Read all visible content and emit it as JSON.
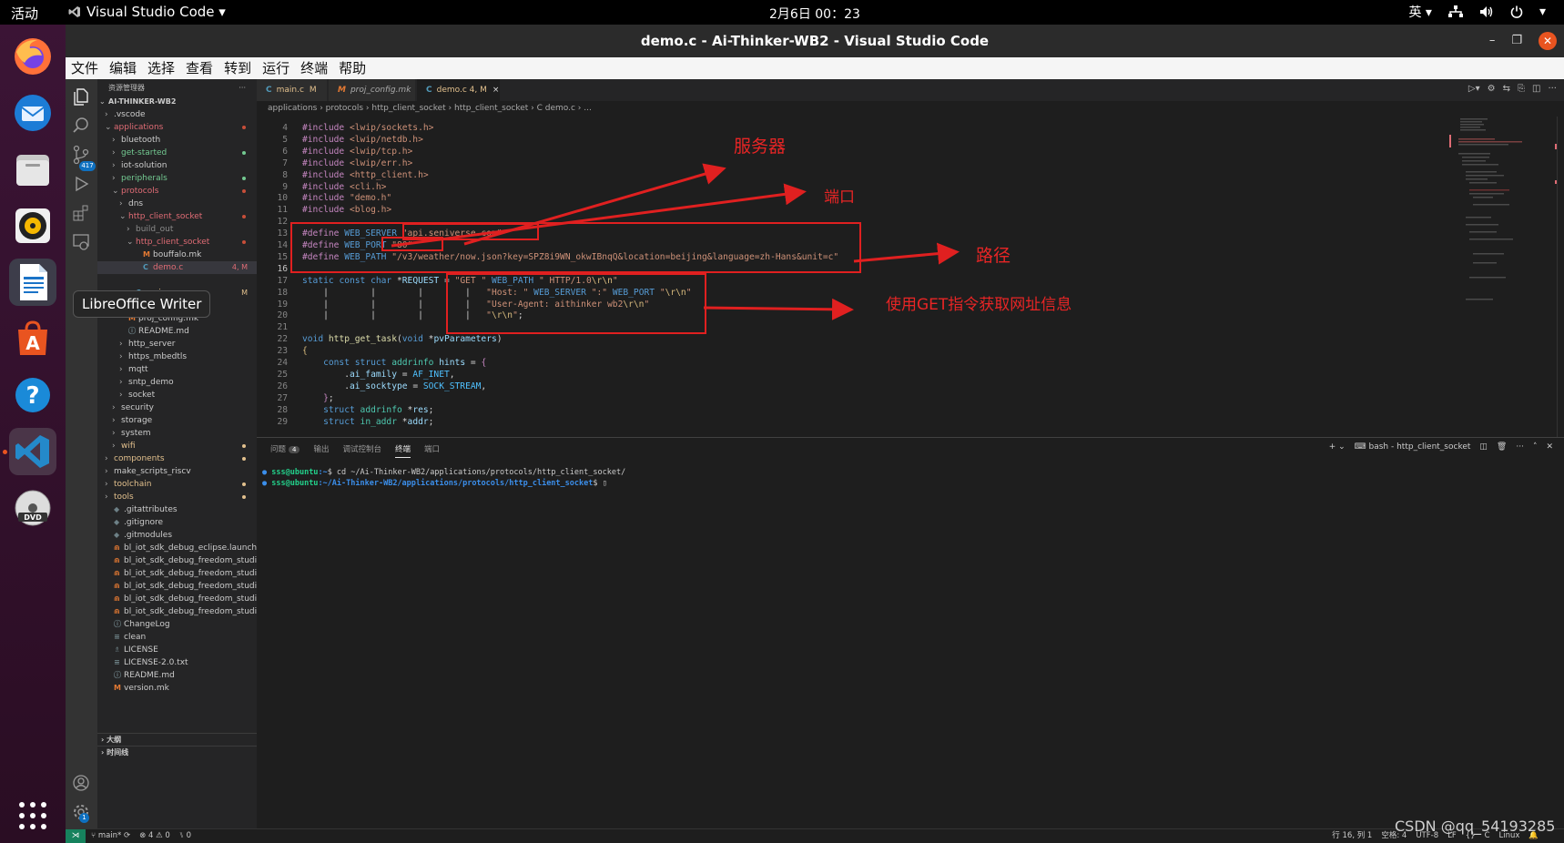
{
  "topbar": {
    "activities": "活动",
    "app_name": "Visual Studio Code ▾",
    "clock": "2月6日  00：23",
    "lang": "英 ▾",
    "network_icon": "network-icon",
    "volume_icon": "volume-icon",
    "power_icon": "power-icon"
  },
  "dock": {
    "items": [
      "firefox-icon",
      "thunderbird-icon",
      "files-icon",
      "rhythmbox-icon",
      "libreoffice-writer-icon",
      "app-center-icon",
      "help-icon",
      "vscode-icon",
      "dvd-icon",
      "show-apps-icon"
    ],
    "tooltip": "LibreOffice Writer"
  },
  "window": {
    "title": "demo.c - Ai-Thinker-WB2 - Visual Studio Code"
  },
  "menu": [
    "文件",
    "编辑",
    "选择",
    "查看",
    "转到",
    "运行",
    "终端",
    "帮助"
  ],
  "activity": {
    "scm_badge": "417",
    "settings_badge": "1"
  },
  "explorer": {
    "title": "资源管理器",
    "more": "···",
    "root": "AI-THINKER-WB2",
    "rows": [
      {
        "label": ".vscode",
        "indent": 1,
        "chev": "›",
        "icon": "",
        "color": "#cccccc"
      },
      {
        "label": "applications",
        "indent": 1,
        "chev": "⌄",
        "icon": "",
        "color": "#e06c75",
        "dot": "#c74e39"
      },
      {
        "label": "bluetooth",
        "indent": 2,
        "chev": "›",
        "icon": "",
        "color": "#cccccc"
      },
      {
        "label": "get-started",
        "indent": 2,
        "chev": "›",
        "icon": "",
        "color": "#73c991",
        "dot": "#73c991"
      },
      {
        "label": "iot-solution",
        "indent": 2,
        "chev": "›",
        "icon": "",
        "color": "#cccccc"
      },
      {
        "label": "peripherals",
        "indent": 2,
        "chev": "›",
        "icon": "",
        "color": "#73c991",
        "dot": "#73c991"
      },
      {
        "label": "protocols",
        "indent": 2,
        "chev": "⌄",
        "icon": "",
        "color": "#e06c75",
        "dot": "#c74e39"
      },
      {
        "label": "dns",
        "indent": 3,
        "chev": "›",
        "icon": "",
        "color": "#cccccc"
      },
      {
        "label": "http_client_socket",
        "indent": 3,
        "chev": "⌄",
        "icon": "",
        "color": "#e06c75",
        "dot": "#c74e39"
      },
      {
        "label": "build_out",
        "indent": 4,
        "chev": "›",
        "icon": "",
        "color": "#8b8b8b"
      },
      {
        "label": "http_client_socket",
        "indent": 4,
        "chev": "⌄",
        "icon": "",
        "color": "#e06c75",
        "dot": "#c74e39"
      },
      {
        "label": "bouffalo.mk",
        "indent": 5,
        "chev": "",
        "icon": "M",
        "color": "#cccccc"
      },
      {
        "label": "demo.c",
        "indent": 5,
        "chev": "",
        "icon": "C",
        "color": "#e06c75",
        "badge": "4, M",
        "selected": true
      },
      {
        "label": "",
        "indent": 5,
        "chev": "",
        "icon": "",
        "color": "#cccccc"
      },
      {
        "label": "main.c",
        "indent": 4,
        "chev": "",
        "icon": "C",
        "color": "#e2c08d",
        "badge": "M"
      },
      {
        "label": "Makefile",
        "indent": 3,
        "chev": "",
        "icon": "M",
        "color": "#cccccc"
      },
      {
        "label": "proj_config.mk",
        "indent": 3,
        "chev": "",
        "icon": "M",
        "color": "#cccccc"
      },
      {
        "label": "README.md",
        "indent": 3,
        "chev": "",
        "icon": "ⓘ",
        "color": "#cccccc"
      },
      {
        "label": "http_server",
        "indent": 3,
        "chev": "›",
        "icon": "",
        "color": "#cccccc"
      },
      {
        "label": "https_mbedtls",
        "indent": 3,
        "chev": "›",
        "icon": "",
        "color": "#cccccc"
      },
      {
        "label": "mqtt",
        "indent": 3,
        "chev": "›",
        "icon": "",
        "color": "#cccccc"
      },
      {
        "label": "sntp_demo",
        "indent": 3,
        "chev": "›",
        "icon": "",
        "color": "#cccccc"
      },
      {
        "label": "socket",
        "indent": 3,
        "chev": "›",
        "icon": "",
        "color": "#cccccc"
      },
      {
        "label": "security",
        "indent": 2,
        "chev": "›",
        "icon": "",
        "color": "#cccccc"
      },
      {
        "label": "storage",
        "indent": 2,
        "chev": "›",
        "icon": "",
        "color": "#cccccc"
      },
      {
        "label": "system",
        "indent": 2,
        "chev": "›",
        "icon": "",
        "color": "#cccccc"
      },
      {
        "label": "wifi",
        "indent": 2,
        "chev": "›",
        "icon": "",
        "color": "#e2c08d",
        "dot": "#e2c08d"
      },
      {
        "label": "components",
        "indent": 1,
        "chev": "›",
        "icon": "",
        "color": "#e2c08d",
        "dot": "#e2c08d"
      },
      {
        "label": "make_scripts_riscv",
        "indent": 1,
        "chev": "›",
        "icon": "",
        "color": "#cccccc"
      },
      {
        "label": "toolchain",
        "indent": 1,
        "chev": "›",
        "icon": "",
        "color": "#e2c08d",
        "dot": "#e2c08d"
      },
      {
        "label": "tools",
        "indent": 1,
        "chev": "›",
        "icon": "",
        "color": "#e2c08d",
        "dot": "#e2c08d"
      },
      {
        "label": ".gitattributes",
        "indent": 1,
        "chev": "",
        "icon": "◆",
        "color": "#cccccc"
      },
      {
        "label": ".gitignore",
        "indent": 1,
        "chev": "",
        "icon": "◆",
        "color": "#cccccc"
      },
      {
        "label": ".gitmodules",
        "indent": 1,
        "chev": "",
        "icon": "◆",
        "color": "#cccccc"
      },
      {
        "label": "bl_iot_sdk_debug_eclipse.launch",
        "indent": 1,
        "chev": "",
        "icon": "⋒",
        "color": "#cccccc"
      },
      {
        "label": "bl_iot_sdk_debug_freedom_studio...",
        "indent": 1,
        "chev": "",
        "icon": "⋒",
        "color": "#cccccc"
      },
      {
        "label": "bl_iot_sdk_debug_freedom_studio...",
        "indent": 1,
        "chev": "",
        "icon": "⋒",
        "color": "#cccccc"
      },
      {
        "label": "bl_iot_sdk_debug_freedom_studio...",
        "indent": 1,
        "chev": "",
        "icon": "⋒",
        "color": "#cccccc"
      },
      {
        "label": "bl_iot_sdk_debug_freedom_studio...",
        "indent": 1,
        "chev": "",
        "icon": "⋒",
        "color": "#cccccc"
      },
      {
        "label": "bl_iot_sdk_debug_freedom_studio...",
        "indent": 1,
        "chev": "",
        "icon": "⋒",
        "color": "#cccccc"
      },
      {
        "label": "ChangeLog",
        "indent": 1,
        "chev": "",
        "icon": "ⓘ",
        "color": "#cccccc"
      },
      {
        "label": "clean",
        "indent": 1,
        "chev": "",
        "icon": "≡",
        "color": "#cccccc"
      },
      {
        "label": "LICENSE",
        "indent": 1,
        "chev": "",
        "icon": "♗",
        "color": "#cccccc"
      },
      {
        "label": "LICENSE-2.0.txt",
        "indent": 1,
        "chev": "",
        "icon": "≡",
        "color": "#cccccc"
      },
      {
        "label": "README.md",
        "indent": 1,
        "chev": "",
        "icon": "ⓘ",
        "color": "#cccccc"
      },
      {
        "label": "version.mk",
        "indent": 1,
        "chev": "",
        "icon": "M",
        "color": "#cccccc"
      }
    ],
    "outline": "大纲",
    "timeline": "时间线"
  },
  "tabs": [
    {
      "icon": "C",
      "label": "main.c",
      "badge": "M",
      "italic": false
    },
    {
      "icon": "M",
      "label": "proj_config.mk",
      "badge": "",
      "italic": true
    },
    {
      "icon": "C",
      "label": "demo.c 4, M",
      "badge": "",
      "italic": false,
      "active": true
    }
  ],
  "tab_close": "×",
  "breadcrumb": "applications › protocols › http_client_socket › http_client_socket › C demo.c › ...",
  "code": [
    {
      "n": "4",
      "html": "<span class='k-pp'>#include</span> <span class='k-inc'>&lt;lwip/sockets.h&gt;</span>"
    },
    {
      "n": "5",
      "html": "<span class='k-pp'>#include</span> <span class='k-inc'>&lt;lwip/netdb.h&gt;</span>"
    },
    {
      "n": "6",
      "html": "<span class='k-pp'>#include</span> <span class='k-inc'>&lt;lwip/tcp.h&gt;</span>"
    },
    {
      "n": "7",
      "html": "<span class='k-pp'>#include</span> <span class='k-inc'>&lt;lwip/err.h&gt;</span>"
    },
    {
      "n": "8",
      "html": "<span class='k-pp'>#include</span> <span class='k-inc'>&lt;http_client.h&gt;</span>"
    },
    {
      "n": "9",
      "html": "<span class='k-pp'>#include</span> <span class='k-inc'>&lt;cli.h&gt;</span>"
    },
    {
      "n": "10",
      "html": "<span class='k-pp'>#include</span> <span class='k-inc'>\"demo.h\"</span>"
    },
    {
      "n": "11",
      "html": "<span class='k-pp'>#include</span> <span class='k-inc'>&lt;blog.h&gt;</span>"
    },
    {
      "n": "12",
      "html": ""
    },
    {
      "n": "13",
      "html": "<span class='k-pp'>#define</span> <span class='k-mac'>WEB_SERVER</span> <span class='k-str'>\"api.seniverse.com\"</span>"
    },
    {
      "n": "14",
      "html": "<span class='k-pp'>#define</span> <span class='k-mac'>WEB_PORT</span> <span class='k-str'>\"80\"</span>"
    },
    {
      "n": "15",
      "html": "<span class='k-pp'>#define</span> <span class='k-mac'>WEB_PATH</span> <span class='k-str'>\"/v3/weather/now.json?key=SPZ8i9WN_okwIBnqQ&amp;location=beijing&amp;language=zh-Hans&amp;unit=c\"</span>"
    },
    {
      "n": "16",
      "html": "",
      "cur": true
    },
    {
      "n": "17",
      "html": "<span class='k-kw'>static</span> <span class='k-kw'>const</span> <span class='k-kw'>char</span> <span class='k-txt'>*</span><span class='k-var'>REQUEST</span> <span class='k-txt'>=</span> <span class='k-str'>\"GET \"</span> <span class='k-mac'>WEB_PATH</span> <span class='k-str'>\" HTTP/1.0</span><span class='k-esc'>\\r\\n</span><span class='k-str'>\"</span>"
    },
    {
      "n": "18",
      "html": "<span class='k-txt'>    |        |        |        |   </span><span class='k-str'>\"Host: \"</span> <span class='k-mac'>WEB_SERVER</span> <span class='k-str'>\":\"</span> <span class='k-mac'>WEB_PORT</span> <span class='k-str'>\"</span><span class='k-esc'>\\r\\n</span><span class='k-str'>\"</span>"
    },
    {
      "n": "19",
      "html": "<span class='k-txt'>    |        |        |        |   </span><span class='k-str'>\"User-Agent: aithinker wb2</span><span class='k-esc'>\\r\\n</span><span class='k-str'>\"</span>"
    },
    {
      "n": "20",
      "html": "<span class='k-txt'>    |        |        |        |   </span><span class='k-str'>\"</span><span class='k-esc'>\\r\\n</span><span class='k-str'>\"</span><span class='k-txt'>;</span>"
    },
    {
      "n": "21",
      "html": ""
    },
    {
      "n": "22",
      "html": "<span class='k-kw'>void</span> <span class='k-fn'>http_get_task</span><span class='k-txt'>(</span><span class='k-kw'>void</span> <span class='k-txt'>*</span><span class='k-var'>pvParameters</span><span class='k-txt'>)</span>"
    },
    {
      "n": "23",
      "html": "<span class='k-esc'>{</span>"
    },
    {
      "n": "24",
      "html": "<span class='k-txt'>    </span><span class='k-kw'>const</span> <span class='k-kw'>struct</span> <span class='k-type'>addrinfo</span> <span class='k-var'>hints</span> <span class='k-txt'>=</span> <span class='k-pp'>{</span>"
    },
    {
      "n": "25",
      "html": "<span class='k-txt'>        .</span><span class='k-var'>ai_family</span> <span class='k-txt'>=</span> <span class='k-const'>AF_INET</span><span class='k-txt'>,</span>"
    },
    {
      "n": "26",
      "html": "<span class='k-txt'>        .</span><span class='k-var'>ai_socktype</span> <span class='k-txt'>=</span> <span class='k-const'>SOCK_STREAM</span><span class='k-txt'>,</span>"
    },
    {
      "n": "27",
      "html": "<span class='k-txt'>    </span><span class='k-pp'>}</span><span class='k-txt'>;</span>"
    },
    {
      "n": "28",
      "html": "<span class='k-txt'>    </span><span class='k-kw'>struct</span> <span class='k-type'>addrinfo</span> <span class='k-txt'>*</span><span class='k-var'>res</span><span class='k-txt'>;</span>"
    },
    {
      "n": "29",
      "html": "<span class='k-txt'>    </span><span class='k-kw'>struct</span> <span class='k-type'>in_addr</span> <span class='k-txt'>*</span><span class='k-var'>addr</span><span class='k-txt'>;</span>"
    }
  ],
  "panel": {
    "tabs": [
      "问题",
      "输出",
      "调试控制台",
      "终端",
      "端口"
    ],
    "problems_count": "4",
    "terminal_name": "bash - http_client_socket",
    "lines": [
      {
        "user": "sss@ubuntu",
        "path": ":~",
        "cmd": "$ cd ~/Ai-Thinker-WB2/applications/protocols/http_client_socket/"
      },
      {
        "user": "sss@ubuntu",
        "path": ":~/Ai-Thinker-WB2/applications/protocols/http_client_socket",
        "cmd": "$ ▯"
      }
    ]
  },
  "status": {
    "branch": "main*",
    "sync": "⟳",
    "problems": "⊗ 4 ⚠ 0",
    "ports": "⑊ 0",
    "position": "行 16, 列 1",
    "spaces": "空格: 4",
    "encoding": "UTF-8",
    "eol": "LF",
    "lang": "C",
    "os": "Linux"
  },
  "annotations": {
    "server": "服务器",
    "port": "端口",
    "path": "路径",
    "get": "使用GET指令获取网址信息"
  },
  "watermark": "CSDN @qq_54193285"
}
